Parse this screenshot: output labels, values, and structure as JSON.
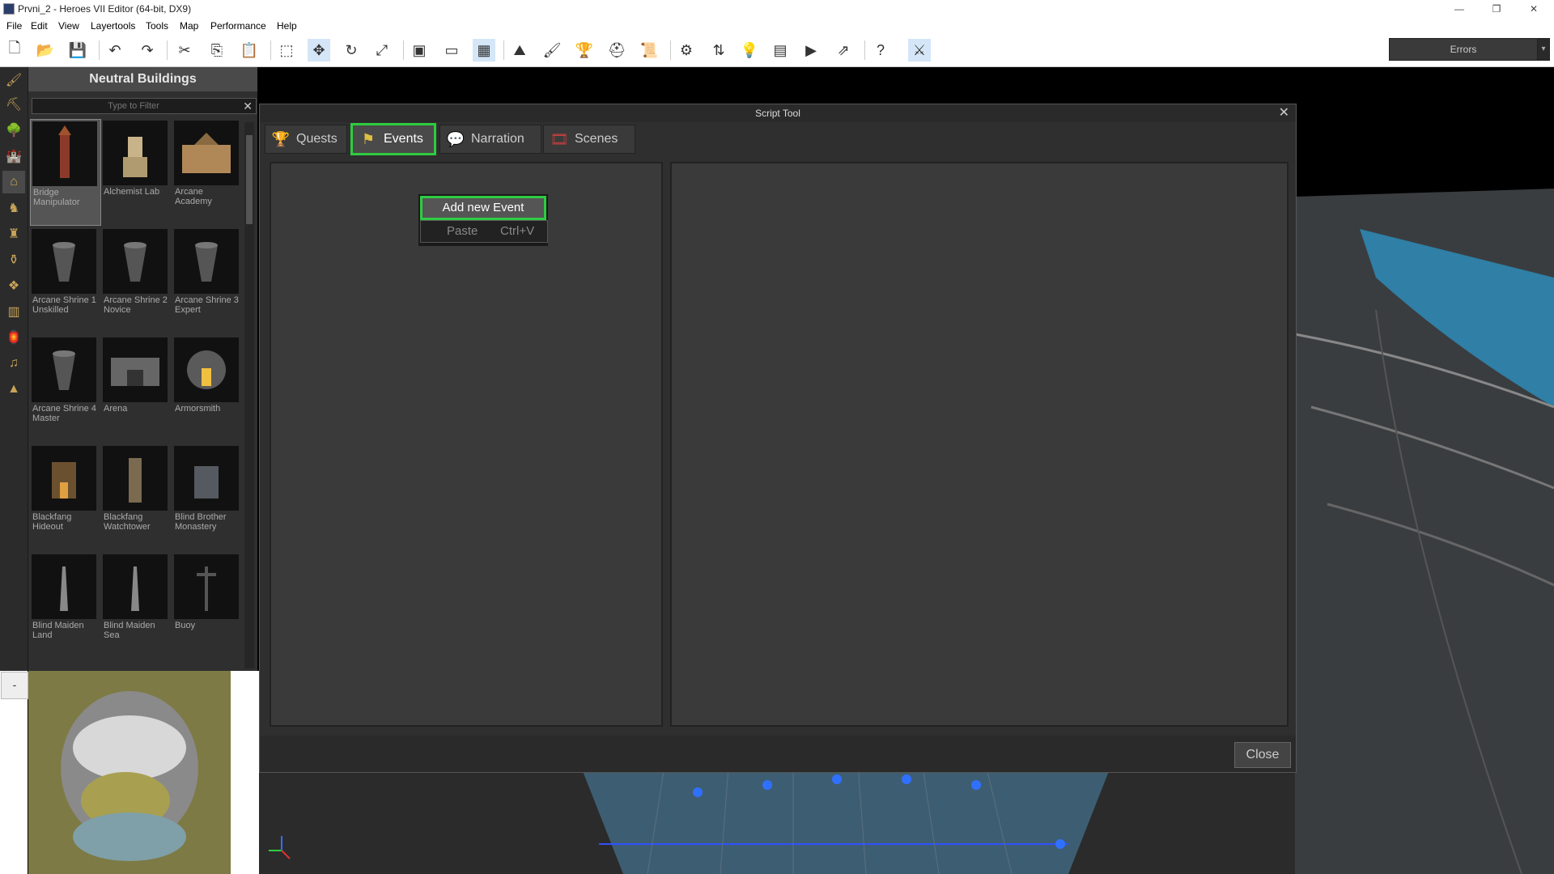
{
  "window": {
    "title": "Prvni_2 - Heroes VII Editor (64-bit, DX9)",
    "minimize": "—",
    "restore": "❐",
    "close": "✕"
  },
  "menu": [
    "File",
    "Edit",
    "View",
    "Layertools",
    "Tools",
    "Map",
    "Performance",
    "Help"
  ],
  "toolbar": {
    "errors_label": "Errors",
    "errors_dropdown": "▾"
  },
  "palette": {
    "title": "Neutral Buildings",
    "filter_placeholder": "Type to Filter",
    "filter_clear": "✕",
    "items": [
      {
        "label": "Bridge Manipulator",
        "selected": true
      },
      {
        "label": "Alchemist Lab"
      },
      {
        "label": "Arcane Academy"
      },
      {
        "label": "Arcane Shrine 1 Unskilled"
      },
      {
        "label": "Arcane Shrine 2 Novice"
      },
      {
        "label": "Arcane Shrine 3 Expert"
      },
      {
        "label": "Arcane Shrine 4 Master"
      },
      {
        "label": "Arena"
      },
      {
        "label": "Armorsmith"
      },
      {
        "label": "Blackfang Hideout"
      },
      {
        "label": "Blackfang Watchtower"
      },
      {
        "label": "Blind Brother Monastery"
      },
      {
        "label": "Blind Maiden Land"
      },
      {
        "label": "Blind Maiden Sea"
      },
      {
        "label": "Buoy"
      }
    ]
  },
  "minimap": {
    "toggle": "-"
  },
  "dialog": {
    "title": "Script Tool",
    "close_icon": "✕",
    "tabs": [
      {
        "label": "Quests",
        "icon": "trophy-icon"
      },
      {
        "label": "Events",
        "icon": "flag-icon",
        "active": true
      },
      {
        "label": "Narration",
        "icon": "speech-bubble-icon"
      },
      {
        "label": "Scenes",
        "icon": "film-icon"
      }
    ],
    "context_menu": {
      "add": "Add new Event",
      "paste": "Paste",
      "paste_shortcut": "Ctrl+V"
    },
    "close_button": "Close"
  },
  "colors": {
    "active_highlight": "#2ecc40",
    "panel": "#3a3a3a"
  }
}
